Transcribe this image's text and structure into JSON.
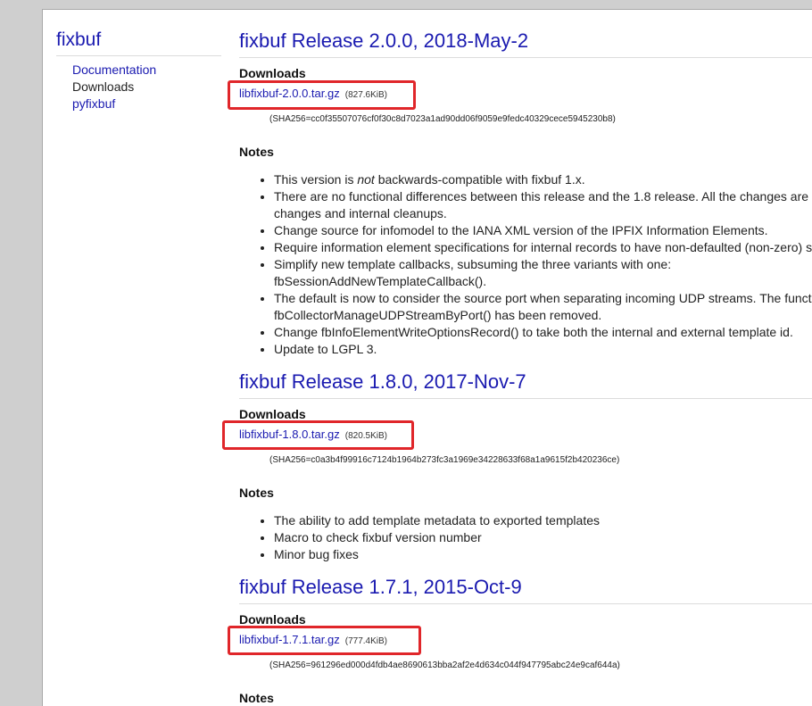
{
  "sidebar": {
    "title": "fixbuf",
    "nav": [
      {
        "label": "Documentation"
      },
      {
        "label": "Downloads"
      },
      {
        "label": "pyfixbuf"
      }
    ]
  },
  "colors": {
    "link": "#1a1ab0",
    "highlight": "#e0262a",
    "rule": "#dcdcdc"
  },
  "releases": [
    {
      "title": "fixbuf Release 2.0.0, 2018-May-2",
      "downloads_heading": "Downloads",
      "file": "libfixbuf-2.0.0.tar.gz",
      "size": "(827.6KiB)",
      "sha": "(SHA256=cc0f35507076cf0f30c8d7023a1ad90dd06f9059e9fedc40329cece5945230b8)",
      "notes_heading": "Notes",
      "notes": [
        {
          "pre": "This version is ",
          "em": "not",
          "post": " backwards-compatible with fixbuf 1.x."
        },
        {
          "text": "There are no functional differences between this release and the 1.8 release. All the changes are"
        },
        {
          "text": "changes and internal cleanups."
        },
        {
          "text": "Change source for infomodel to the IANA XML version of the IPFIX Information Elements."
        },
        {
          "text": "Require information element specifications for internal records to have non-defaulted (non-zero) s"
        },
        {
          "text": "Simplify new template callbacks, subsuming the three variants with one:"
        },
        {
          "text": "fbSessionAddNewTemplateCallback()."
        },
        {
          "text": "The default is now to consider the source port when separating incoming UDP streams. The funct"
        },
        {
          "text": "fbCollectorManageUDPStreamByPort() has been removed."
        },
        {
          "text": "Change fbInfoElementWriteOptionsRecord() to take both the internal and external template id."
        },
        {
          "text": "Update to LGPL 3."
        }
      ]
    },
    {
      "title": "fixbuf Release 1.8.0, 2017-Nov-7",
      "downloads_heading": "Downloads",
      "file": "libfixbuf-1.8.0.tar.gz",
      "size": "(820.5KiB)",
      "sha": "(SHA256=c0a3b4f99916c7124b1964b273fc3a1969e34228633f68a1a9615f2b420236ce)",
      "notes_heading": "Notes",
      "notes": [
        {
          "text": "The ability to add template metadata to exported templates"
        },
        {
          "text": "Macro to check fixbuf version number"
        },
        {
          "text": "Minor bug fixes"
        }
      ]
    },
    {
      "title": "fixbuf Release 1.7.1, 2015-Oct-9",
      "downloads_heading": "Downloads",
      "file": "libfixbuf-1.7.1.tar.gz",
      "size": "(777.4KiB)",
      "sha": "(SHA256=961296ed000d4fdb4ae8690613bba2af2e4d634c044f947795abc24e9caf644a)",
      "notes_heading": "Notes"
    }
  ]
}
